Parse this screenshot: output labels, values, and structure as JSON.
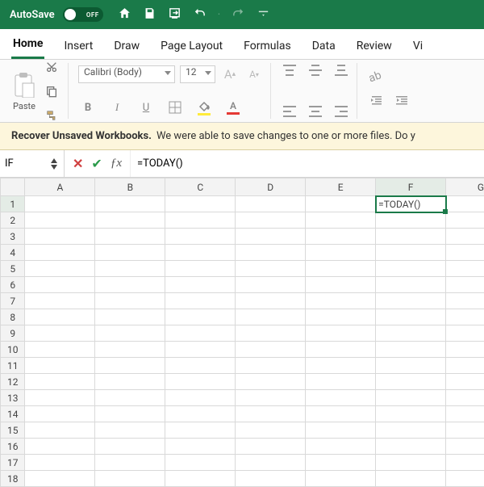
{
  "titlebar": {
    "autosave_label": "AutoSave",
    "autosave_state": "OFF"
  },
  "tabs": [
    "Home",
    "Insert",
    "Draw",
    "Page Layout",
    "Formulas",
    "Data",
    "Review",
    "Vi"
  ],
  "active_tab": "Home",
  "ribbon": {
    "paste_label": "Paste",
    "font_name": "Calibri (Body)",
    "font_size": "12",
    "bold": "B",
    "italic": "I",
    "underline": "U"
  },
  "recover_bar": {
    "title": "Recover Unsaved Workbooks.",
    "message": "We were able to save changes to one or more files. Do y"
  },
  "formula_bar": {
    "name_box": "IF",
    "formula": "=TODAY()"
  },
  "grid": {
    "columns": [
      "A",
      "B",
      "C",
      "D",
      "E",
      "F",
      "G"
    ],
    "rows": [
      1,
      2,
      3,
      4,
      5,
      6,
      7,
      8,
      9,
      10,
      11,
      12,
      13,
      14,
      15,
      16,
      17,
      18
    ],
    "active_cell": {
      "col": "F",
      "row": 1,
      "value": "=TODAY()"
    }
  },
  "colors": {
    "accent": "#1a7a49"
  }
}
